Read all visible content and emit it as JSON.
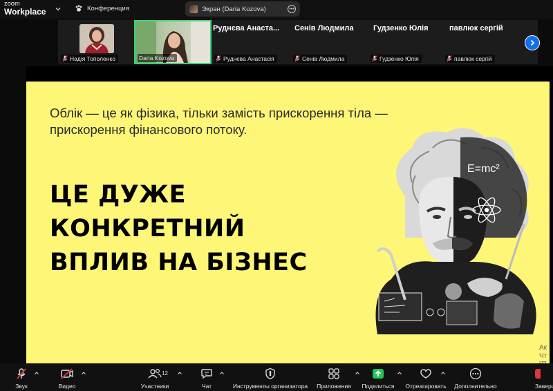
{
  "app": {
    "brand_top": "zoom",
    "brand_bottom": "Workplace"
  },
  "meeting": {
    "label": "Конференция"
  },
  "share": {
    "label": "Экран (Daria Kozova)"
  },
  "participants": [
    {
      "display": "photo",
      "tag": "Надія Тополенко"
    },
    {
      "display": "photo",
      "tag": "Daria Kozova"
    },
    {
      "display": "Руднєва  Анаста...",
      "tag": "Руднєва Анастасія"
    },
    {
      "display": "Сенів Людмила",
      "tag": "Сенів Людмила"
    },
    {
      "display": "Гудзенко Юлія",
      "tag": "Гудзенко Юлія"
    },
    {
      "display": "павлюк сергій",
      "tag": "павлюк сергій"
    }
  ],
  "slide": {
    "quote_line1": "Облік — це як фізика, тільки замість прискорення тіла —",
    "quote_line2": "прискорення фінансового потоку.",
    "headline_line1": "ЦЕ ДУЖЕ",
    "headline_line2": "КОНКРЕТНИЙ",
    "headline_line3": "ВПЛИВ НА БІЗНЕС",
    "formula": "E=mc²",
    "background": "#fdf677"
  },
  "watermark": {
    "line1": "Ак",
    "line2": "Чт",
    "line3": "\"П"
  },
  "toolbar": {
    "audio": "Звук",
    "video": "Видео",
    "participants": "Участники",
    "participants_count": "12",
    "chat": "Чат",
    "host_tools": "Инструменты организатора",
    "apps": "Приложения",
    "share": "Поделиться",
    "react": "Отреагировать",
    "more": "Дополнительно",
    "end": "Заверш"
  },
  "colors": {
    "accent": "#0e71eb",
    "share_green": "#23c35a",
    "muted_red": "#e0353b",
    "active_border": "#37d67a"
  }
}
